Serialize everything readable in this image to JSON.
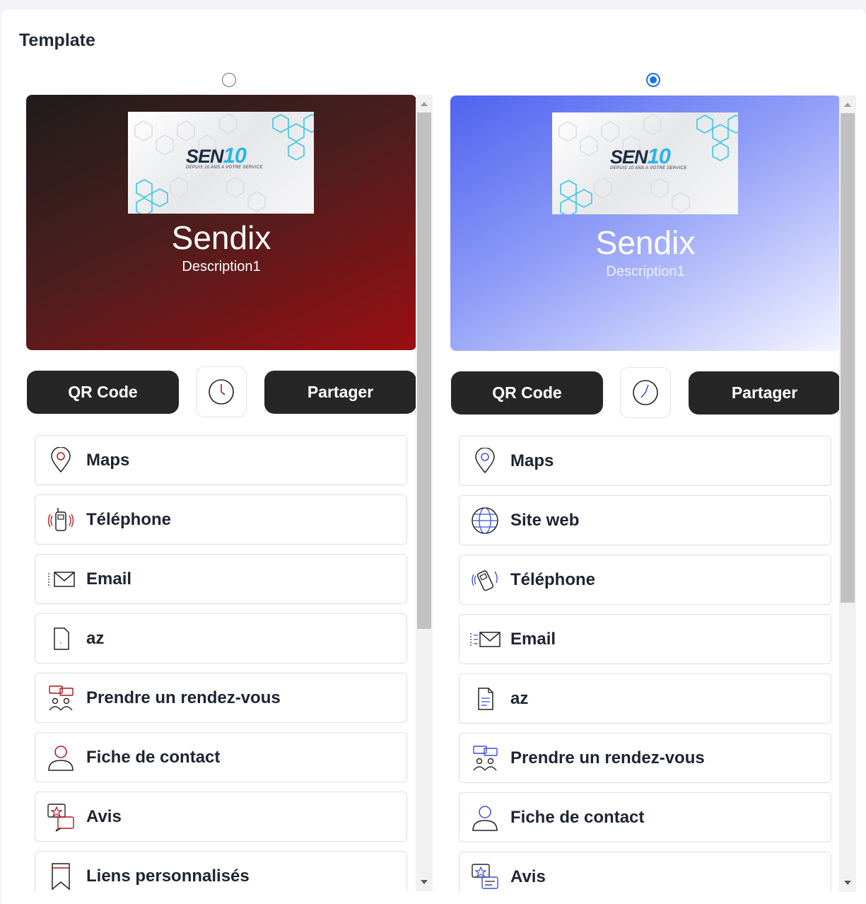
{
  "section": {
    "title": "Template"
  },
  "templates": [
    {
      "selected": false,
      "hero": {
        "name": "Sendix",
        "description": "Description1"
      },
      "buttons": {
        "qr": "QR Code",
        "share": "Partager"
      },
      "links": [
        {
          "label": "Maps",
          "icon": "map-pin-icon"
        },
        {
          "label": "Téléphone",
          "icon": "phone-icon"
        },
        {
          "label": "Email",
          "icon": "email-icon"
        },
        {
          "label": "az",
          "icon": "document-icon"
        },
        {
          "label": "Prendre un rendez-vous",
          "icon": "meeting-icon"
        },
        {
          "label": "Fiche de contact",
          "icon": "contact-icon"
        },
        {
          "label": "Avis",
          "icon": "review-icon"
        },
        {
          "label": "Liens personnalisés",
          "icon": "bookmark-icon"
        }
      ],
      "accent": "#b0141a"
    },
    {
      "selected": true,
      "hero": {
        "name": "Sendix",
        "description": "Description1"
      },
      "buttons": {
        "qr": "QR Code",
        "share": "Partager"
      },
      "links": [
        {
          "label": "Maps",
          "icon": "map-pin-icon"
        },
        {
          "label": "Site web",
          "icon": "globe-icon"
        },
        {
          "label": "Téléphone",
          "icon": "phone-icon"
        },
        {
          "label": "Email",
          "icon": "email-icon"
        },
        {
          "label": "az",
          "icon": "document-icon"
        },
        {
          "label": "Prendre un rendez-vous",
          "icon": "meeting-icon"
        },
        {
          "label": "Fiche de contact",
          "icon": "contact-icon"
        },
        {
          "label": "Avis",
          "icon": "review-icon"
        }
      ],
      "accent": "#3b4fd8"
    }
  ],
  "logo": {
    "brand_a": "SEN",
    "brand_b": "10",
    "tagline": "DEPUIS 10 ANS A VOTRE SERVICE"
  }
}
